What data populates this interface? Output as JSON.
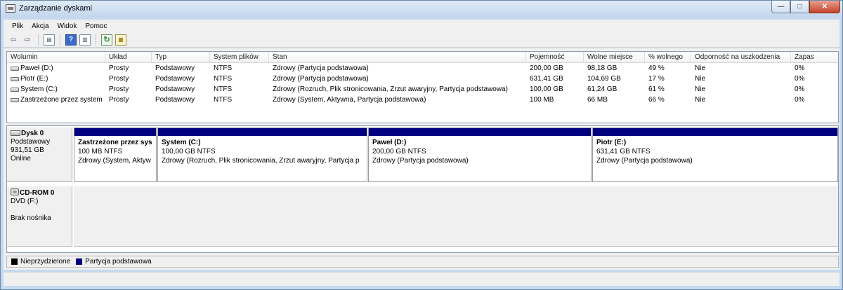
{
  "window": {
    "title": "Zarządzanie dyskami",
    "minimize_symbol": "—",
    "maximize_symbol": "□",
    "close_symbol": "✕"
  },
  "menu": [
    "Plik",
    "Akcja",
    "Widok",
    "Pomoc"
  ],
  "toolbar": {
    "icons": [
      "back-arrow-icon",
      "forward-arrow-icon",
      "console-tree-icon",
      "help-icon",
      "properties-icon",
      "refresh-icon",
      "rescan-disks-icon"
    ],
    "back_symbol": "⇦",
    "forward_symbol": "⇨",
    "help_symbol": "?",
    "refresh_symbol": "↻"
  },
  "volume_table": {
    "columns": [
      "Wolumin",
      "Układ",
      "Typ",
      "System plików",
      "Stan",
      "Pojemność",
      "Wolne miejsce",
      "% wolnego",
      "Odporność na uszkodzenia",
      "Zapas"
    ],
    "rows": [
      [
        "Paweł (D:)",
        "Prosty",
        "Podstawowy",
        "NTFS",
        "Zdrowy (Partycja podstawowa)",
        "200,00 GB",
        "98,18 GB",
        "49 %",
        "Nie",
        "0%"
      ],
      [
        "Piotr (E:)",
        "Prosty",
        "Podstawowy",
        "NTFS",
        "Zdrowy (Partycja podstawowa)",
        "631,41 GB",
        "104,69 GB",
        "17 %",
        "Nie",
        "0%"
      ],
      [
        "System (C:)",
        "Prosty",
        "Podstawowy",
        "NTFS",
        "Zdrowy (Rozruch, Plik stronicowania, Zrzut awaryjny, Partycja podstawowa)",
        "100,00 GB",
        "61,24 GB",
        "61 %",
        "Nie",
        "0%"
      ],
      [
        "Zastrzeżone przez system",
        "Prosty",
        "Podstawowy",
        "NTFS",
        "Zdrowy (System, Aktywna, Partycja podstawowa)",
        "100 MB",
        "66 MB",
        "66 %",
        "Nie",
        "0%"
      ]
    ]
  },
  "disks": [
    {
      "name": "Dysk 0",
      "type": "Podstawowy",
      "size": "931,51 GB",
      "status": "Online",
      "partitions": [
        {
          "name": "Zastrzeżone przez sys",
          "size": "100 MB NTFS",
          "status": "Zdrowy (System, Aktyw"
        },
        {
          "name": "System  (C:)",
          "size": "100,00 GB NTFS",
          "status": "Zdrowy (Rozruch, Plik stronicowania, Zrzut awaryjny, Partycja p"
        },
        {
          "name": "Paweł  (D:)",
          "size": "200,00 GB NTFS",
          "status": "Zdrowy (Partycja podstawowa)"
        },
        {
          "name": "Piotr  (E:)",
          "size": "631,41 GB NTFS",
          "status": "Zdrowy (Partycja podstawowa)"
        }
      ]
    }
  ],
  "cdrom": {
    "name": "CD-ROM 0",
    "drive": "DVD (F:)",
    "media": "Brak nośnika"
  },
  "legend": [
    {
      "label": "Nieprzydzielone",
      "color": "#000000"
    },
    {
      "label": "Partycja podstawowa",
      "color": "#000080"
    }
  ],
  "colors": {
    "primary_partition": "#000080",
    "unallocated": "#000000",
    "window_frame": "#c6d9ef"
  }
}
